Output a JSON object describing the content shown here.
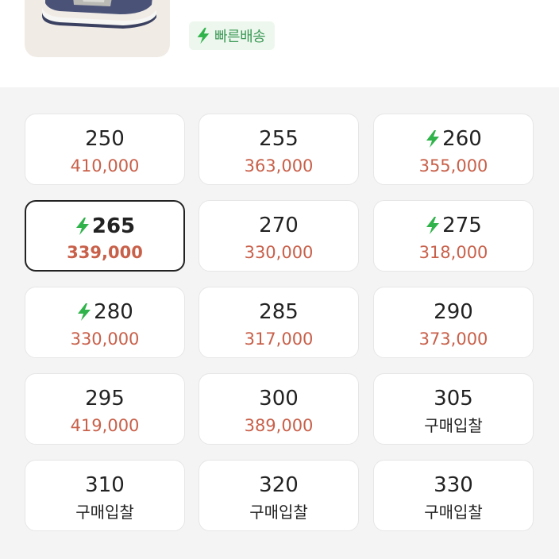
{
  "header": {
    "fast_delivery_label": "빠른배송"
  },
  "colors": {
    "price": "#c8604a",
    "fast_green": "#2fb34a",
    "selected_border": "#222222"
  },
  "sizes": [
    {
      "size": "250",
      "price": "410,000",
      "fast": false,
      "selected": false
    },
    {
      "size": "255",
      "price": "363,000",
      "fast": false,
      "selected": false
    },
    {
      "size": "260",
      "price": "355,000",
      "fast": true,
      "selected": false
    },
    {
      "size": "265",
      "price": "339,000",
      "fast": true,
      "selected": true
    },
    {
      "size": "270",
      "price": "330,000",
      "fast": false,
      "selected": false
    },
    {
      "size": "275",
      "price": "318,000",
      "fast": true,
      "selected": false
    },
    {
      "size": "280",
      "price": "330,000",
      "fast": true,
      "selected": false
    },
    {
      "size": "285",
      "price": "317,000",
      "fast": false,
      "selected": false
    },
    {
      "size": "290",
      "price": "373,000",
      "fast": false,
      "selected": false
    },
    {
      "size": "295",
      "price": "419,000",
      "fast": false,
      "selected": false
    },
    {
      "size": "300",
      "price": "389,000",
      "fast": false,
      "selected": false
    },
    {
      "size": "305",
      "price": "구매입찰",
      "fast": false,
      "selected": false,
      "bid": true
    },
    {
      "size": "310",
      "price": "구매입찰",
      "fast": false,
      "selected": false,
      "bid": true
    },
    {
      "size": "320",
      "price": "구매입찰",
      "fast": false,
      "selected": false,
      "bid": true
    },
    {
      "size": "330",
      "price": "구매입찰",
      "fast": false,
      "selected": false,
      "bid": true
    }
  ]
}
